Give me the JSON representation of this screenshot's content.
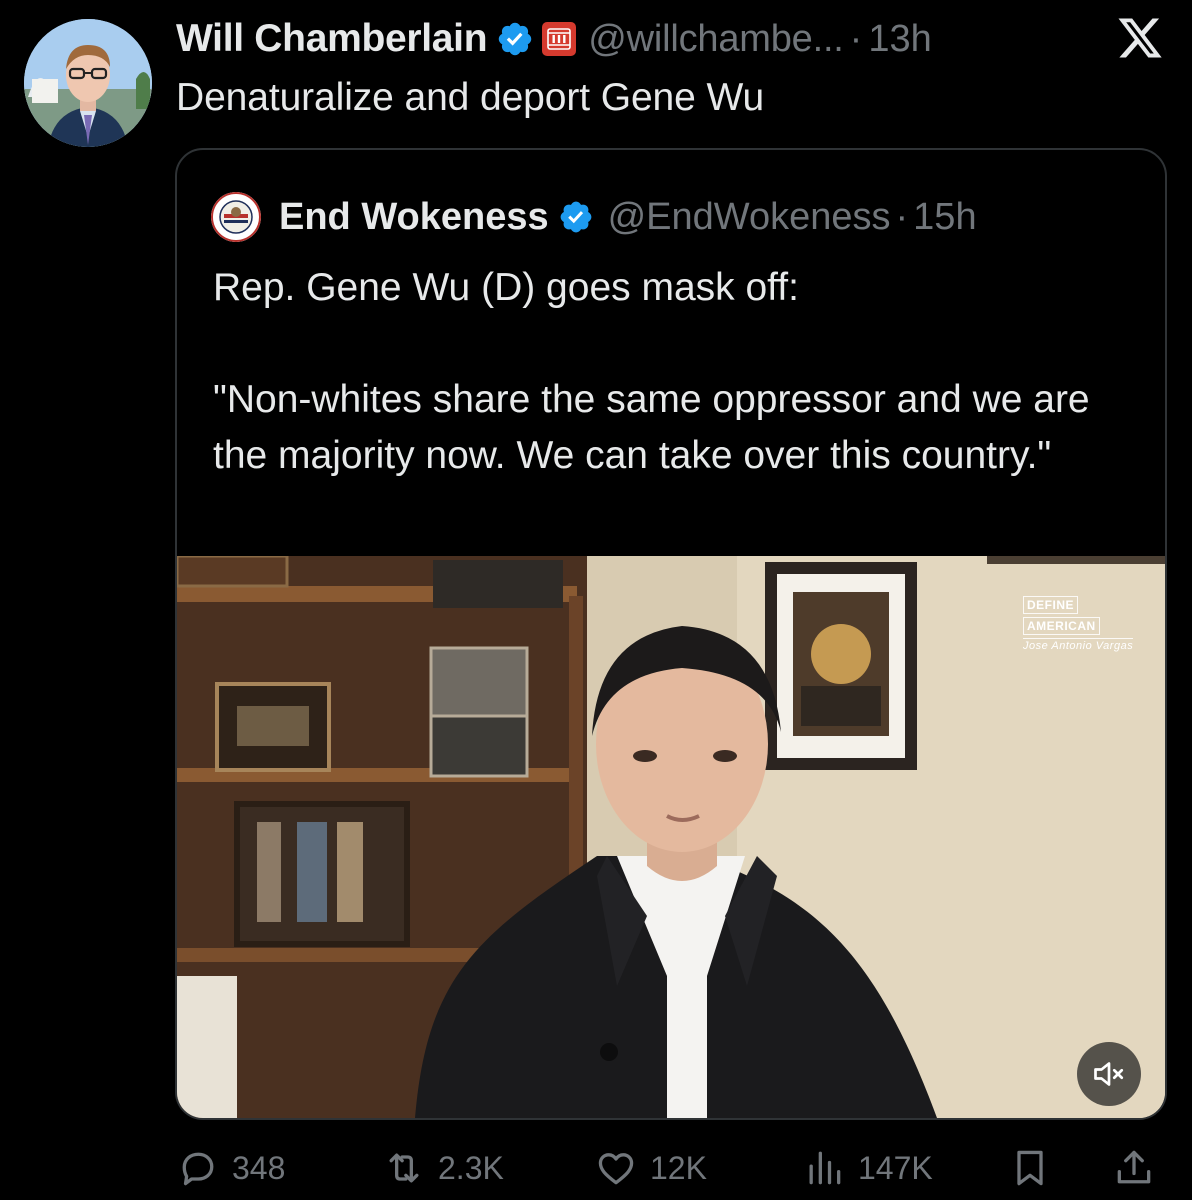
{
  "post": {
    "author_name": "Will Chamberlain",
    "author_handle": "@willchambe...",
    "dot": "·",
    "time": "13h",
    "text": "Denaturalize and deport Gene Wu",
    "affiliation_badge_text": "III"
  },
  "quote": {
    "author_name": "End Wokeness",
    "author_handle": "@EndWokeness",
    "dot": "·",
    "time": "15h",
    "text": "Rep. Gene Wu (D) goes mask off:\n\n\"Non-whites share the same oppressor and we are the majority now. We can take over this country.\"",
    "video_watermark": {
      "line1": "DEFINE",
      "line2": "AMERICAN",
      "signature": "Jose Antonio Vargas"
    }
  },
  "actions": {
    "replies": "348",
    "reposts": "2.3K",
    "likes": "12K",
    "views": "147K"
  },
  "icons": {
    "verified": "verified-badge-icon",
    "x_logo": "x-logo-icon",
    "mute": "volume-muted-icon",
    "reply": "reply-icon",
    "repost": "repost-icon",
    "like": "heart-icon",
    "views": "views-icon",
    "bookmark": "bookmark-icon",
    "share": "share-icon"
  },
  "colors": {
    "background": "#000000",
    "text": "#e7e9ea",
    "secondary": "#71767b",
    "verified_blue": "#1d9bf0",
    "border": "#2f3336",
    "affiliation_red": "#d53a2e"
  }
}
